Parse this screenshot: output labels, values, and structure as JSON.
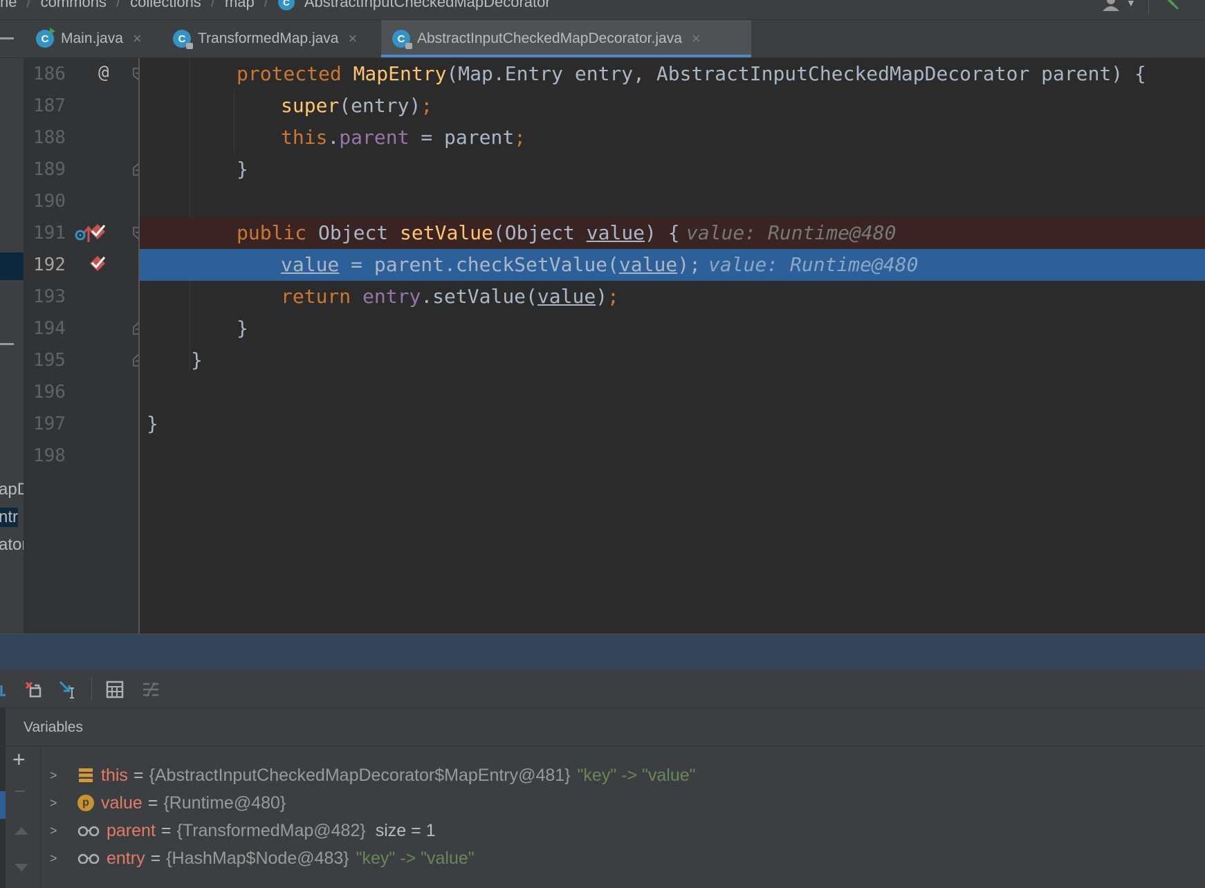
{
  "breadcrumb": {
    "items": [
      "ne",
      "commons",
      "collections",
      "map",
      "AbstractInputCheckedMapDecorator"
    ],
    "separator": "/"
  },
  "tabs": [
    {
      "label": "Main.java",
      "close": "×"
    },
    {
      "label": "TransformedMap.java",
      "close": "×"
    },
    {
      "label": "AbstractInputCheckedMapDecorator.java",
      "close": "×"
    }
  ],
  "left_panel": {
    "labels": [
      "apD",
      "ntr",
      "ator"
    ]
  },
  "editor": {
    "current_line": 192,
    "line_numbers": [
      "186",
      "187",
      "188",
      "189",
      "190",
      "191",
      "192",
      "193",
      "194",
      "195",
      "196",
      "197",
      "198"
    ],
    "gutter_annotation_186": "@",
    "code": {
      "l186": {
        "kw": "protected ",
        "fn": "MapEntry",
        "rest": "(Map.Entry entry, AbstractInputCheckedMapDecorator parent) {"
      },
      "l187": {
        "fn": "super",
        "rest": "(entry)",
        "semi": ";"
      },
      "l188": {
        "kw": "this",
        "dot": ".",
        "fld": "parent",
        "rest": " = parent",
        "semi": ";"
      },
      "l189": "}",
      "l191": {
        "kw": "public ",
        "type": "Object ",
        "fn": "setValue",
        "open": "(Object ",
        "param": "value",
        "close": ") {",
        "hint": "value: Runtime@480"
      },
      "l192": {
        "var": "value",
        "eq": " = ",
        "fld": "parent",
        "call": ".checkSetValue(",
        "param": "value",
        "close": ")",
        "semi": ";",
        "hint": "value: Runtime@480"
      },
      "l193": {
        "kw": "return ",
        "fld": "entry",
        "call": ".setValue(",
        "param": "value",
        "close": ")",
        "semi": ";"
      },
      "l194": "}",
      "l195": "}",
      "l197": "}"
    }
  },
  "variables": {
    "title": "Variables",
    "add": "+",
    "remove": "−",
    "rows": [
      {
        "name": "this",
        "eq": "=",
        "value": "{AbstractInputCheckedMapDecorator$MapEntry@481}",
        "str": "\"key\" -> \"value\"",
        "icon": "field-stack-icon"
      },
      {
        "name": "value",
        "eq": "=",
        "value": "{Runtime@480}",
        "icon": "parameter-icon",
        "icon_text": "p"
      },
      {
        "name": "parent",
        "eq": "=",
        "value": "{TransformedMap@482}",
        "extra": "size = 1",
        "icon": "watch-glasses-icon"
      },
      {
        "name": "entry",
        "eq": "=",
        "value": "{HashMap$Node@483}",
        "str": "\"key\" -> \"value\"",
        "icon": "watch-glasses-icon"
      }
    ]
  },
  "colors": {
    "keyword": "#cc7832",
    "function": "#ffc66d",
    "field": "#9876aa",
    "string": "#6a8759",
    "exec_line": "#2d6099",
    "breakpoint": "#c75450",
    "accent": "#4a88c7"
  }
}
